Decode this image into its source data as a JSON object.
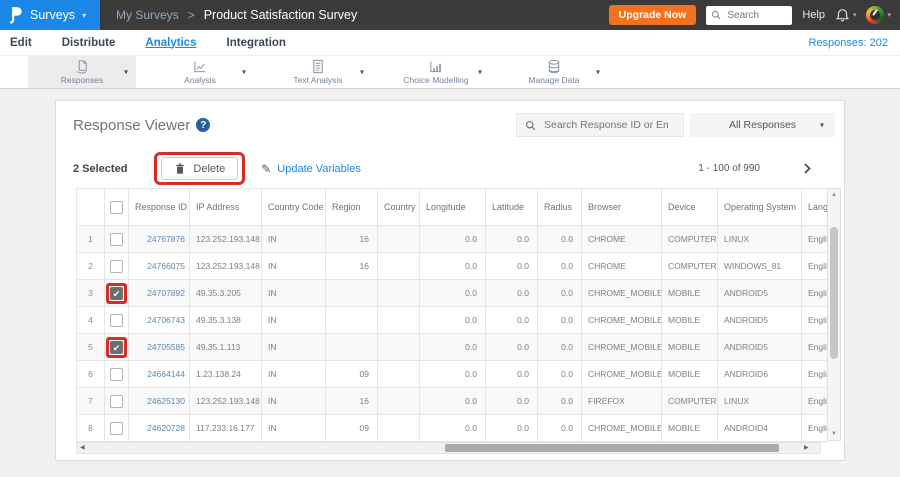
{
  "topbar": {
    "product_menu": "Surveys",
    "breadcrumb_parent": "My Surveys",
    "breadcrumb_sep": ">",
    "breadcrumb_current": "Product Satisfaction Survey",
    "upgrade_button": "Upgrade Now",
    "search_placeholder": "Search",
    "help_label": "Help"
  },
  "nav": {
    "items": [
      "Edit",
      "Distribute",
      "Analytics",
      "Integration"
    ],
    "active_item": "Analytics",
    "responses_count_label": "Responses: 202"
  },
  "toolbar": {
    "tabs": [
      {
        "label": "Responses",
        "icon": "responses-icon",
        "active": true
      },
      {
        "label": "Analysis",
        "icon": "analysis-icon",
        "active": false
      },
      {
        "label": "Text Analysis",
        "icon": "text-analysis-icon",
        "active": false
      },
      {
        "label": "Choice Modelling",
        "icon": "choice-modelling-icon",
        "active": false
      },
      {
        "label": "Manage Data",
        "icon": "manage-data-icon",
        "active": false
      }
    ]
  },
  "panel": {
    "title": "Response Viewer",
    "help_icon": "?",
    "search_placeholder": "Search Response ID or Email",
    "filter_dropdown": "All Responses",
    "selected_label": "2 Selected",
    "delete_button": "Delete",
    "update_variables_button": "Update Variables",
    "pagination": "1 - 100 of 990"
  },
  "annotations": {
    "delete_button_highlighted": true,
    "highlighted_checkbox_rows": [
      3,
      5
    ],
    "annotation_color": "#d92b25"
  },
  "table": {
    "columns": [
      "Response ID",
      "IP Address",
      "Country Code",
      "Region",
      "Country",
      "Longitude",
      "Latitude",
      "Radius",
      "Browser",
      "Device",
      "Operating System",
      "Language"
    ],
    "sort_column": "Response ID",
    "sort_direction": "asc",
    "rows": [
      {
        "num": "1",
        "checked": false,
        "annotated": false,
        "response_id": "24767876",
        "ip_address": "123.252.193.148",
        "country_code": "IN",
        "region": "16",
        "country": "",
        "longitude": "0.0",
        "latitude": "0.0",
        "radius": "0.0",
        "browser": "CHROME",
        "device": "COMPUTER",
        "operating_system": "LINUX",
        "language": "English"
      },
      {
        "num": "2",
        "checked": false,
        "annotated": false,
        "response_id": "24766075",
        "ip_address": "123.252.193.148",
        "country_code": "IN",
        "region": "16",
        "country": "",
        "longitude": "0.0",
        "latitude": "0.0",
        "radius": "0.0",
        "browser": "CHROME",
        "device": "COMPUTER",
        "operating_system": "WINDOWS_81",
        "language": "English"
      },
      {
        "num": "3",
        "checked": true,
        "annotated": true,
        "response_id": "24707892",
        "ip_address": "49.35.3.205",
        "country_code": "IN",
        "region": "",
        "country": "",
        "longitude": "0.0",
        "latitude": "0.0",
        "radius": "0.0",
        "browser": "CHROME_MOBILE",
        "device": "MOBILE",
        "operating_system": "ANDROID5",
        "language": "English"
      },
      {
        "num": "4",
        "checked": false,
        "annotated": false,
        "response_id": "24706743",
        "ip_address": "49.35.3.138",
        "country_code": "IN",
        "region": "",
        "country": "",
        "longitude": "0.0",
        "latitude": "0.0",
        "radius": "0.0",
        "browser": "CHROME_MOBILE",
        "device": "MOBILE",
        "operating_system": "ANDROID5",
        "language": "English"
      },
      {
        "num": "5",
        "checked": true,
        "annotated": true,
        "response_id": "24705585",
        "ip_address": "49.35.1.113",
        "country_code": "IN",
        "region": "",
        "country": "",
        "longitude": "0.0",
        "latitude": "0.0",
        "radius": "0.0",
        "browser": "CHROME_MOBILE",
        "device": "MOBILE",
        "operating_system": "ANDROID5",
        "language": "English"
      },
      {
        "num": "6",
        "checked": false,
        "annotated": false,
        "response_id": "24664144",
        "ip_address": "1.23.138.24",
        "country_code": "IN",
        "region": "09",
        "country": "",
        "longitude": "0.0",
        "latitude": "0.0",
        "radius": "0.0",
        "browser": "CHROME_MOBILE",
        "device": "MOBILE",
        "operating_system": "ANDROID6",
        "language": "English"
      },
      {
        "num": "7",
        "checked": false,
        "annotated": false,
        "response_id": "24625130",
        "ip_address": "123.252.193.148",
        "country_code": "IN",
        "region": "16",
        "country": "",
        "longitude": "0.0",
        "latitude": "0.0",
        "radius": "0.0",
        "browser": "FIREFOX",
        "device": "COMPUTER",
        "operating_system": "LINUX",
        "language": "English"
      },
      {
        "num": "8",
        "checked": false,
        "annotated": false,
        "response_id": "24620728",
        "ip_address": "117.233.16.177",
        "country_code": "IN",
        "region": "09",
        "country": "",
        "longitude": "0.0",
        "latitude": "0.0",
        "radius": "0.0",
        "browser": "CHROME_MOBILE",
        "device": "MOBILE",
        "operating_system": "ANDROID4",
        "language": "English"
      }
    ]
  },
  "colors": {
    "accent_blue": "#1b87e6",
    "upgrade_orange": "#f47120",
    "annotation_red": "#d92b25",
    "topbar_dark": "#3b3b3b",
    "link_blue": "#5a86b5"
  }
}
